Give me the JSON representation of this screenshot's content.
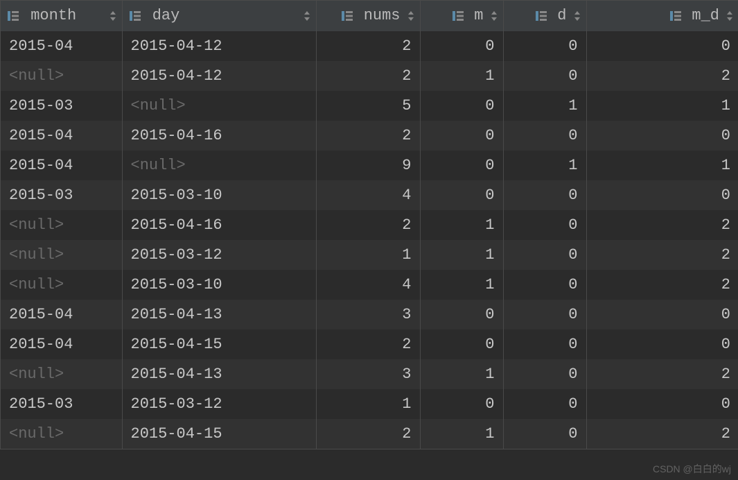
{
  "columns": [
    {
      "key": "month",
      "label": "month",
      "type": "text"
    },
    {
      "key": "day",
      "label": "day",
      "type": "text"
    },
    {
      "key": "nums",
      "label": "nums",
      "type": "num"
    },
    {
      "key": "m",
      "label": "m",
      "type": "num"
    },
    {
      "key": "d",
      "label": "d",
      "type": "num"
    },
    {
      "key": "m_d",
      "label": "m_d",
      "type": "num"
    }
  ],
  "null_text": "<null>",
  "rows": [
    {
      "month": "2015-04",
      "day": "2015-04-12",
      "nums": 2,
      "m": 0,
      "d": 0,
      "m_d": 0
    },
    {
      "month": null,
      "day": "2015-04-12",
      "nums": 2,
      "m": 1,
      "d": 0,
      "m_d": 2
    },
    {
      "month": "2015-03",
      "day": null,
      "nums": 5,
      "m": 0,
      "d": 1,
      "m_d": 1
    },
    {
      "month": "2015-04",
      "day": "2015-04-16",
      "nums": 2,
      "m": 0,
      "d": 0,
      "m_d": 0
    },
    {
      "month": "2015-04",
      "day": null,
      "nums": 9,
      "m": 0,
      "d": 1,
      "m_d": 1
    },
    {
      "month": "2015-03",
      "day": "2015-03-10",
      "nums": 4,
      "m": 0,
      "d": 0,
      "m_d": 0
    },
    {
      "month": null,
      "day": "2015-04-16",
      "nums": 2,
      "m": 1,
      "d": 0,
      "m_d": 2
    },
    {
      "month": null,
      "day": "2015-03-12",
      "nums": 1,
      "m": 1,
      "d": 0,
      "m_d": 2
    },
    {
      "month": null,
      "day": "2015-03-10",
      "nums": 4,
      "m": 1,
      "d": 0,
      "m_d": 2
    },
    {
      "month": "2015-04",
      "day": "2015-04-13",
      "nums": 3,
      "m": 0,
      "d": 0,
      "m_d": 0
    },
    {
      "month": "2015-04",
      "day": "2015-04-15",
      "nums": 2,
      "m": 0,
      "d": 0,
      "m_d": 0
    },
    {
      "month": null,
      "day": "2015-04-13",
      "nums": 3,
      "m": 1,
      "d": 0,
      "m_d": 2
    },
    {
      "month": "2015-03",
      "day": "2015-03-12",
      "nums": 1,
      "m": 0,
      "d": 0,
      "m_d": 0
    },
    {
      "month": null,
      "day": "2015-04-15",
      "nums": 2,
      "m": 1,
      "d": 0,
      "m_d": 2
    }
  ],
  "watermark": "CSDN @白白的wj"
}
